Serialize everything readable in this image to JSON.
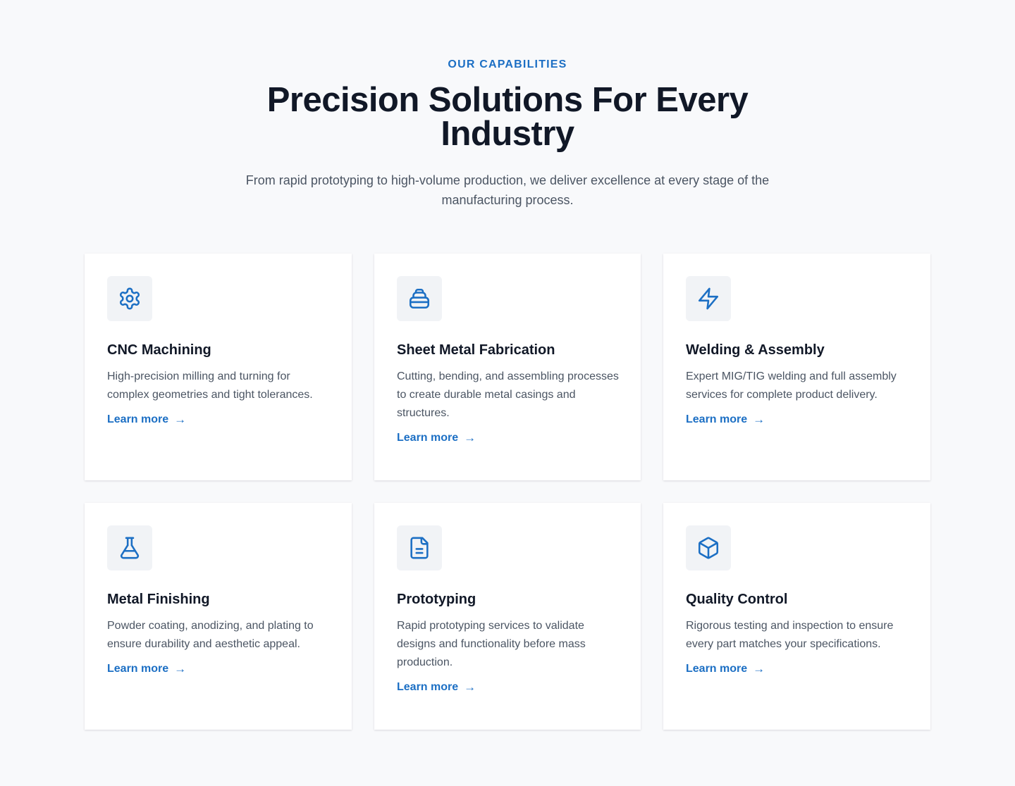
{
  "header": {
    "eyebrow": "OUR CAPABILITIES",
    "title": "Precision Solutions For Every Industry",
    "subtitle": "From rapid prototyping to high-volume production, we deliver excellence at every stage of the manufacturing process."
  },
  "cards": [
    {
      "icon": "gear-icon",
      "title": "CNC Machining",
      "description": "High-precision milling and turning for complex geometries and tight tolerances.",
      "link_label": "Learn more",
      "link_arrow": "→"
    },
    {
      "icon": "layers-icon",
      "title": "Sheet Metal Fabrication",
      "description": "Cutting, bending, and assembling processes to create durable metal casings and structures.",
      "link_label": "Learn more",
      "link_arrow": "→"
    },
    {
      "icon": "lightning-icon",
      "title": "Welding & Assembly",
      "description": "Expert MIG/TIG welding and full assembly services for complete product delivery.",
      "link_label": "Learn more",
      "link_arrow": "→"
    },
    {
      "icon": "flask-icon",
      "title": "Metal Finishing",
      "description": "Powder coating, anodizing, and plating to ensure durability and aesthetic appeal.",
      "link_label": "Learn more",
      "link_arrow": "→"
    },
    {
      "icon": "document-icon",
      "title": "Prototyping",
      "description": "Rapid prototyping services to validate designs and functionality before mass production.",
      "link_label": "Learn more",
      "link_arrow": "→"
    },
    {
      "icon": "cube-icon",
      "title": "Quality Control",
      "description": "Rigorous testing and inspection to ensure every part matches your specifications.",
      "link_label": "Learn more",
      "link_arrow": "→"
    }
  ],
  "colors": {
    "accent": "#1c6fc4",
    "heading": "#111827",
    "body_text": "#4b5563",
    "page_background": "#f8f9fb",
    "card_background": "#ffffff",
    "icon_background": "#f1f3f6"
  }
}
